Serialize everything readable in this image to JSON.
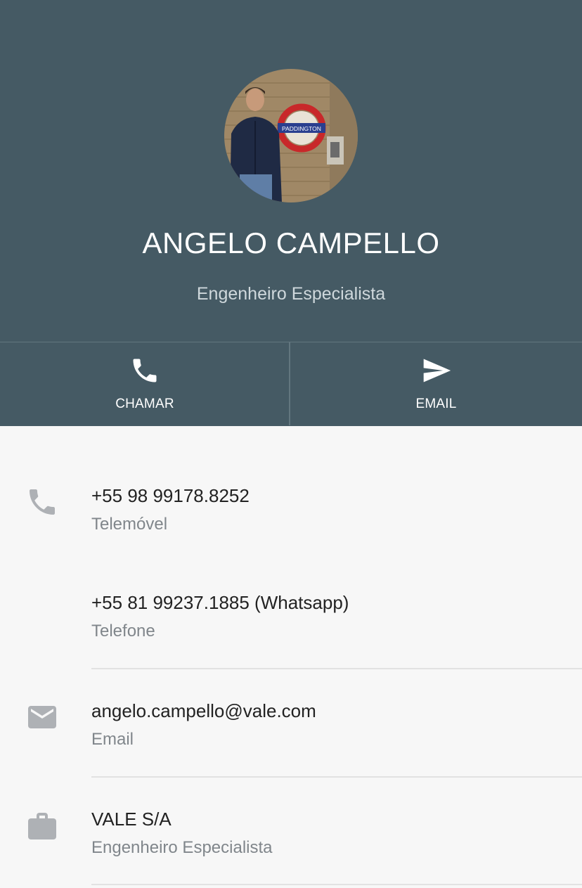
{
  "contact": {
    "name": "ANGELO CAMPELLO",
    "title": "Engenheiro Especialista"
  },
  "actions": {
    "call_label": "CHAMAR",
    "email_label": "EMAIL"
  },
  "details": {
    "phone1": {
      "value": "+55 98 99178.8252",
      "type": "Telemóvel"
    },
    "phone2": {
      "value": "+55 81 99237.1885 (Whatsapp)",
      "type": "Telefone"
    },
    "email": {
      "value": "angelo.campello@vale.com",
      "type": "Email"
    },
    "company": {
      "value": "VALE S/A",
      "role": "Engenheiro Especialista"
    }
  },
  "icons": {
    "call": "phone-icon",
    "send": "send-icon",
    "phone": "phone-icon",
    "email": "mail-icon",
    "company": "briefcase-icon"
  },
  "colors": {
    "header_bg": "#455a64",
    "icon_gray": "#aeb1b5",
    "page_bg": "#f7f7f7"
  }
}
